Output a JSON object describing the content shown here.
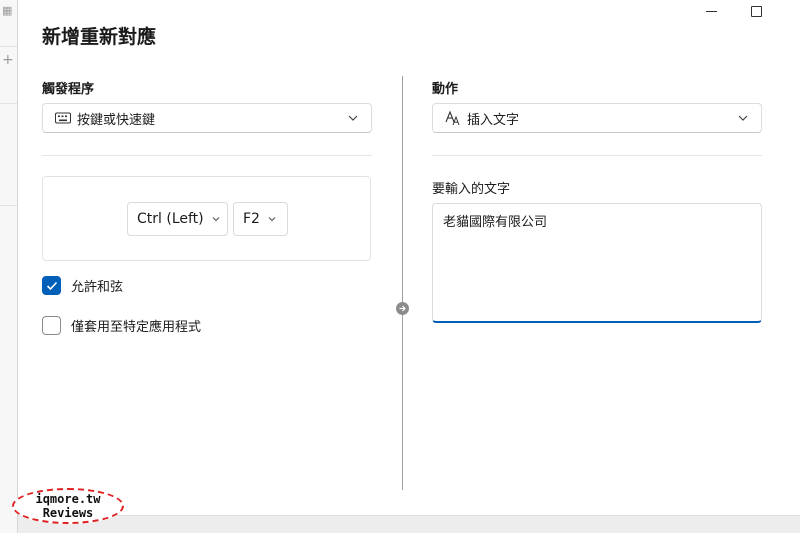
{
  "dialog": {
    "title": "新增重新對應"
  },
  "trigger": {
    "label": "觸發程序",
    "dropdown": {
      "value": "按鍵或快速鍵",
      "icon": "keyboard-icon"
    },
    "keys": [
      {
        "label": "Ctrl (Left)"
      },
      {
        "label": "F2"
      }
    ],
    "allow_chords": {
      "label": "允許和弦",
      "checked": true
    },
    "app_specific": {
      "label": "僅套用至特定應用程式",
      "checked": false
    }
  },
  "action": {
    "label": "動作",
    "dropdown": {
      "value": "插入文字",
      "icon": "text-font-icon"
    },
    "text_label": "要輸入的文字",
    "text_value": "老貓國際有限公司"
  },
  "watermark": {
    "line1": "iqmore.tw",
    "line2": "Reviews"
  },
  "colors": {
    "accent": "#005fb8"
  }
}
